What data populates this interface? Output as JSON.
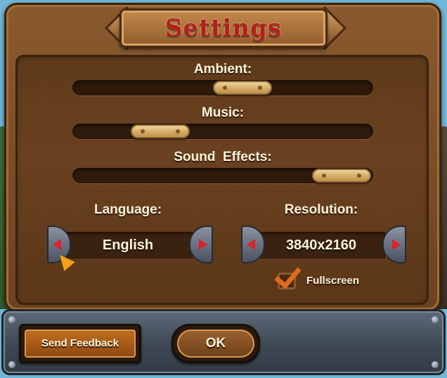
{
  "dialog": {
    "title": "Settings"
  },
  "sliders": [
    {
      "label": "Ambient:",
      "value": 0.58
    },
    {
      "label": "Music:",
      "value": 0.24
    },
    {
      "label": "Sound  Effects:",
      "value": 0.99
    }
  ],
  "language": {
    "label": "Language:",
    "value": "English"
  },
  "resolution": {
    "label": "Resolution:",
    "value": "3840x2160"
  },
  "fullscreen": {
    "label": "Fullscreen",
    "checked": true
  },
  "buttons": {
    "send_feedback": "Send Feedback",
    "ok": "OK"
  },
  "icons": {
    "prev": "left-triangle-arrow-icon",
    "next": "right-triangle-arrow-icon",
    "check": "checkmark-icon",
    "cursor": "mouse-pointer-icon"
  },
  "colors": {
    "title_text": "#b3201a",
    "arrow_red": "#d8242a",
    "check_orange": "#e06a1e",
    "label_text": "#fbf3dc"
  }
}
